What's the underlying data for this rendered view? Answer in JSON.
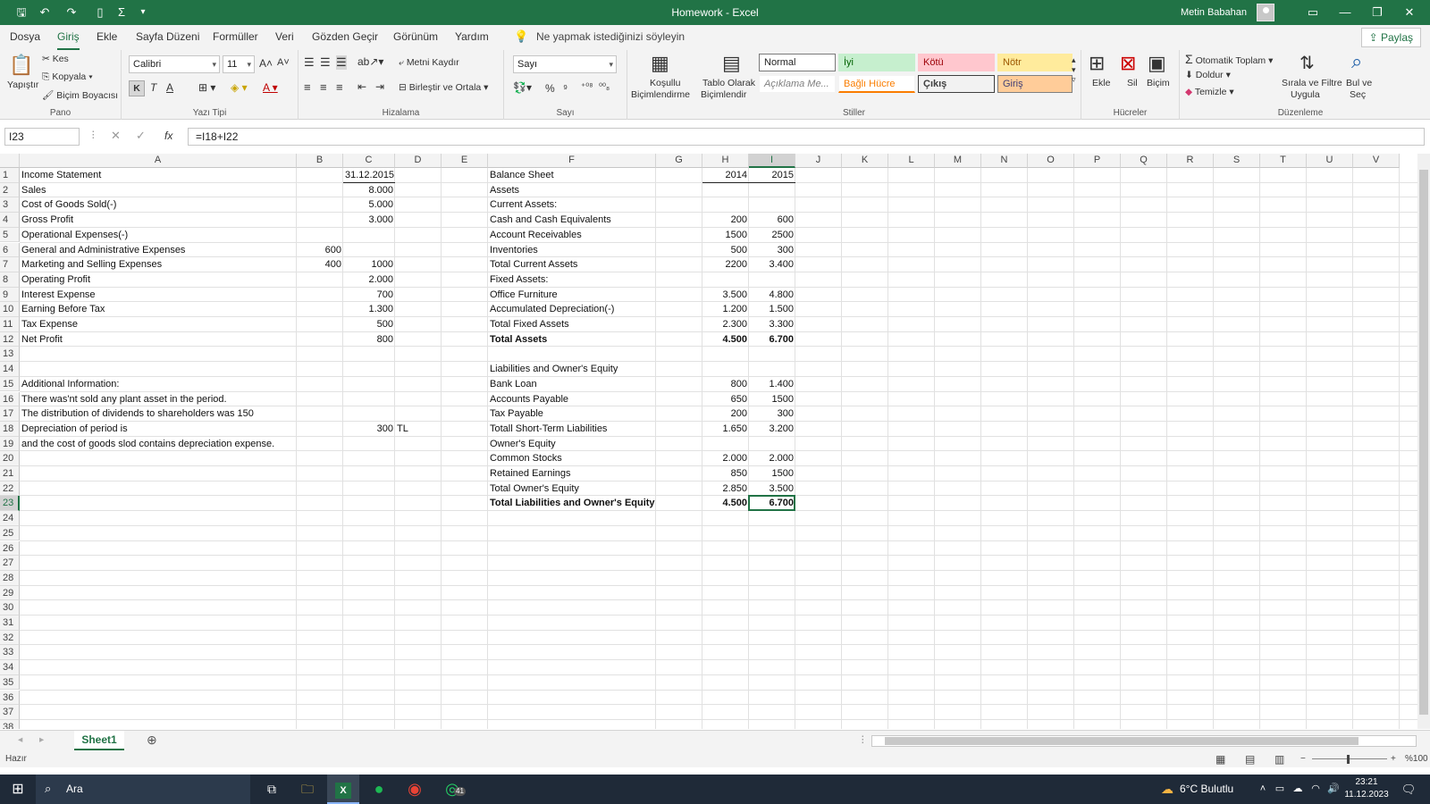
{
  "window": {
    "title": "Homework - Excel",
    "user": "Metin Babahan"
  },
  "menu": {
    "tabs": [
      "Dosya",
      "Giriş",
      "Ekle",
      "Sayfa Düzeni",
      "Formüller",
      "Veri",
      "Gözden Geçir",
      "Görünüm",
      "Yardım"
    ],
    "tell_me": "Ne yapmak istediğinizi söyleyin",
    "share": "Paylaş"
  },
  "ribbon": {
    "clipboard": {
      "label": "Pano",
      "paste": "Yapıştır",
      "cut": "Kes",
      "copy": "Kopyala",
      "painter": "Biçim Boyacısı"
    },
    "font": {
      "label": "Yazı Tipi",
      "name": "Calibri",
      "size": "11",
      "bold": "K",
      "italic": "T",
      "underline": "A"
    },
    "align": {
      "label": "Hizalama",
      "wrap": "Metni Kaydır",
      "merge": "Birleştir ve Ortala"
    },
    "number": {
      "label": "Sayı",
      "format": "Sayı"
    },
    "styles": {
      "label": "Stiller",
      "conditional": "Koşullu",
      "conditional2": "Biçimlendirme",
      "table": "Tablo Olarak",
      "table2": "Biçimlendir",
      "normal": "Normal",
      "good": "İyi",
      "bad": "Kötü",
      "neutral": "Nötr",
      "explanatory": "Açıklama Me...",
      "linked": "Bağlı Hücre",
      "output": "Çıkış",
      "input": "Giriş"
    },
    "cells": {
      "label": "Hücreler",
      "insert": "Ekle",
      "delete": "Sil",
      "format": "Biçim"
    },
    "editing": {
      "label": "Düzenleme",
      "autosum": "Otomatik Toplam",
      "fill": "Doldur",
      "clear": "Temizle",
      "sort": "Sırala ve Filtre",
      "sort2": "Uygula",
      "find": "Bul ve",
      "find2": "Seç"
    }
  },
  "formula_bar": {
    "name_box": "I23",
    "fx": "fx",
    "formula": "=I18+I22"
  },
  "columns": [
    "A",
    "B",
    "C",
    "D",
    "E",
    "F",
    "G",
    "H",
    "I",
    "J",
    "K",
    "L",
    "M",
    "N",
    "O",
    "P",
    "Q",
    "R",
    "S",
    "T",
    "U",
    "V"
  ],
  "rows": [
    "1",
    "2",
    "3",
    "4",
    "5",
    "6",
    "7",
    "8",
    "9",
    "10",
    "11",
    "12",
    "13",
    "14",
    "15",
    "16",
    "17",
    "18",
    "19",
    "20",
    "21",
    "22",
    "23",
    "24",
    "25",
    "26",
    "27",
    "28",
    "29",
    "30",
    "31",
    "32",
    "33",
    "34",
    "35",
    "36",
    "37",
    "38"
  ],
  "cells": [
    {
      "c": "A",
      "r": 1,
      "v": "Income Statement"
    },
    {
      "c": "C",
      "r": 1,
      "v": "31.12.2015",
      "n": 1
    },
    {
      "c": "A",
      "r": 2,
      "v": "Sales"
    },
    {
      "c": "C",
      "r": 2,
      "v": "8.000",
      "n": 1
    },
    {
      "c": "A",
      "r": 3,
      "v": "Cost of Goods Sold(-)"
    },
    {
      "c": "C",
      "r": 3,
      "v": "5.000",
      "n": 1
    },
    {
      "c": "A",
      "r": 4,
      "v": "Gross Profit"
    },
    {
      "c": "C",
      "r": 4,
      "v": "3.000",
      "n": 1
    },
    {
      "c": "A",
      "r": 5,
      "v": "Operational Expenses(-)"
    },
    {
      "c": "A",
      "r": 6,
      "v": "General and Administrative Expenses"
    },
    {
      "c": "B",
      "r": 6,
      "v": "600",
      "n": 1
    },
    {
      "c": "A",
      "r": 7,
      "v": "Marketing and Selling Expenses"
    },
    {
      "c": "B",
      "r": 7,
      "v": "400",
      "n": 1
    },
    {
      "c": "C",
      "r": 7,
      "v": "1000",
      "n": 1
    },
    {
      "c": "A",
      "r": 8,
      "v": "Operating Profit"
    },
    {
      "c": "C",
      "r": 8,
      "v": "2.000",
      "n": 1
    },
    {
      "c": "A",
      "r": 9,
      "v": "Interest Expense"
    },
    {
      "c": "C",
      "r": 9,
      "v": "700",
      "n": 1
    },
    {
      "c": "A",
      "r": 10,
      "v": "Earning Before Tax"
    },
    {
      "c": "C",
      "r": 10,
      "v": "1.300",
      "n": 1
    },
    {
      "c": "A",
      "r": 11,
      "v": "Tax Expense"
    },
    {
      "c": "C",
      "r": 11,
      "v": "500",
      "n": 1
    },
    {
      "c": "A",
      "r": 12,
      "v": "Net Profit"
    },
    {
      "c": "C",
      "r": 12,
      "v": "800",
      "n": 1
    },
    {
      "c": "A",
      "r": 15,
      "v": "Additional Information:"
    },
    {
      "c": "A",
      "r": 16,
      "v": "There was'nt sold  any plant asset in the period."
    },
    {
      "c": "A",
      "r": 17,
      "v": "The distribution of dividends to shareholders was 150"
    },
    {
      "c": "A",
      "r": 18,
      "v": "Depreciation of period is"
    },
    {
      "c": "C",
      "r": 18,
      "v": "300",
      "n": 1
    },
    {
      "c": "D",
      "r": 18,
      "v": "TL"
    },
    {
      "c": "A",
      "r": 19,
      "v": "and the cost of goods slod contains depreciation expense."
    },
    {
      "c": "F",
      "r": 1,
      "v": "Balance Sheet"
    },
    {
      "c": "H",
      "r": 1,
      "v": "2014",
      "n": 1
    },
    {
      "c": "I",
      "r": 1,
      "v": "2015",
      "n": 1
    },
    {
      "c": "F",
      "r": 2,
      "v": "Assets"
    },
    {
      "c": "F",
      "r": 3,
      "v": "Current Assets:"
    },
    {
      "c": "F",
      "r": 4,
      "v": "Cash and Cash Equivalents"
    },
    {
      "c": "H",
      "r": 4,
      "v": "200",
      "n": 1
    },
    {
      "c": "I",
      "r": 4,
      "v": "600",
      "n": 1
    },
    {
      "c": "F",
      "r": 5,
      "v": "Account Receivables"
    },
    {
      "c": "H",
      "r": 5,
      "v": "1500",
      "n": 1
    },
    {
      "c": "I",
      "r": 5,
      "v": "2500",
      "n": 1
    },
    {
      "c": "F",
      "r": 6,
      "v": "Inventories"
    },
    {
      "c": "H",
      "r": 6,
      "v": "500",
      "n": 1
    },
    {
      "c": "I",
      "r": 6,
      "v": "300",
      "n": 1
    },
    {
      "c": "F",
      "r": 7,
      "v": "Total Current Assets"
    },
    {
      "c": "H",
      "r": 7,
      "v": "2200",
      "n": 1
    },
    {
      "c": "I",
      "r": 7,
      "v": "3.400",
      "n": 1
    },
    {
      "c": "F",
      "r": 8,
      "v": "Fixed Assets:"
    },
    {
      "c": "F",
      "r": 9,
      "v": "Office Furniture"
    },
    {
      "c": "H",
      "r": 9,
      "v": "3.500",
      "n": 1
    },
    {
      "c": "I",
      "r": 9,
      "v": "4.800",
      "n": 1
    },
    {
      "c": "F",
      "r": 10,
      "v": "Accumulated Depreciation(-)"
    },
    {
      "c": "H",
      "r": 10,
      "v": "1.200",
      "n": 1
    },
    {
      "c": "I",
      "r": 10,
      "v": "1.500",
      "n": 1
    },
    {
      "c": "F",
      "r": 11,
      "v": "Total Fixed Assets"
    },
    {
      "c": "H",
      "r": 11,
      "v": "2.300",
      "n": 1
    },
    {
      "c": "I",
      "r": 11,
      "v": "3.300",
      "n": 1
    },
    {
      "c": "F",
      "r": 12,
      "v": "Total Assets",
      "b": 1
    },
    {
      "c": "H",
      "r": 12,
      "v": "4.500",
      "n": 1,
      "b": 1
    },
    {
      "c": "I",
      "r": 12,
      "v": "6.700",
      "n": 1,
      "b": 1
    },
    {
      "c": "F",
      "r": 14,
      "v": "Liabilities and Owner's Equity"
    },
    {
      "c": "F",
      "r": 15,
      "v": "Bank Loan"
    },
    {
      "c": "H",
      "r": 15,
      "v": "800",
      "n": 1
    },
    {
      "c": "I",
      "r": 15,
      "v": "1.400",
      "n": 1
    },
    {
      "c": "F",
      "r": 16,
      "v": "Accounts Payable"
    },
    {
      "c": "H",
      "r": 16,
      "v": "650",
      "n": 1
    },
    {
      "c": "I",
      "r": 16,
      "v": "1500",
      "n": 1
    },
    {
      "c": "F",
      "r": 17,
      "v": "Tax Payable"
    },
    {
      "c": "H",
      "r": 17,
      "v": "200",
      "n": 1
    },
    {
      "c": "I",
      "r": 17,
      "v": "300",
      "n": 1
    },
    {
      "c": "F",
      "r": 18,
      "v": "Totall Short-Term Liabilities"
    },
    {
      "c": "H",
      "r": 18,
      "v": "1.650",
      "n": 1
    },
    {
      "c": "I",
      "r": 18,
      "v": "3.200",
      "n": 1
    },
    {
      "c": "F",
      "r": 19,
      "v": "Owner's Equity"
    },
    {
      "c": "F",
      "r": 20,
      "v": "Common Stocks"
    },
    {
      "c": "H",
      "r": 20,
      "v": "2.000",
      "n": 1
    },
    {
      "c": "I",
      "r": 20,
      "v": "2.000",
      "n": 1
    },
    {
      "c": "F",
      "r": 21,
      "v": "Retained Earnings"
    },
    {
      "c": "H",
      "r": 21,
      "v": "850",
      "n": 1
    },
    {
      "c": "I",
      "r": 21,
      "v": "1500",
      "n": 1
    },
    {
      "c": "F",
      "r": 22,
      "v": "Total Owner's Equity"
    },
    {
      "c": "H",
      "r": 22,
      "v": "2.850",
      "n": 1
    },
    {
      "c": "I",
      "r": 22,
      "v": "3.500",
      "n": 1
    },
    {
      "c": "F",
      "r": 23,
      "v": "Total Liabilities and Owner's Equity",
      "b": 1
    },
    {
      "c": "H",
      "r": 23,
      "v": "4.500",
      "n": 1,
      "b": 1
    },
    {
      "c": "I",
      "r": 23,
      "v": "6.700",
      "n": 1,
      "b": 1
    }
  ],
  "sheet": {
    "tab": "Sheet1",
    "status": "Hazır",
    "zoom": "%100"
  },
  "taskbar": {
    "search": "Ara",
    "weather": "6°C  Bulutlu",
    "time": "23:21",
    "date": "11.12.2023",
    "whatsapp_badge": "41"
  },
  "colors": {
    "accent": "#217346",
    "taskbar": "#1f2a38"
  }
}
